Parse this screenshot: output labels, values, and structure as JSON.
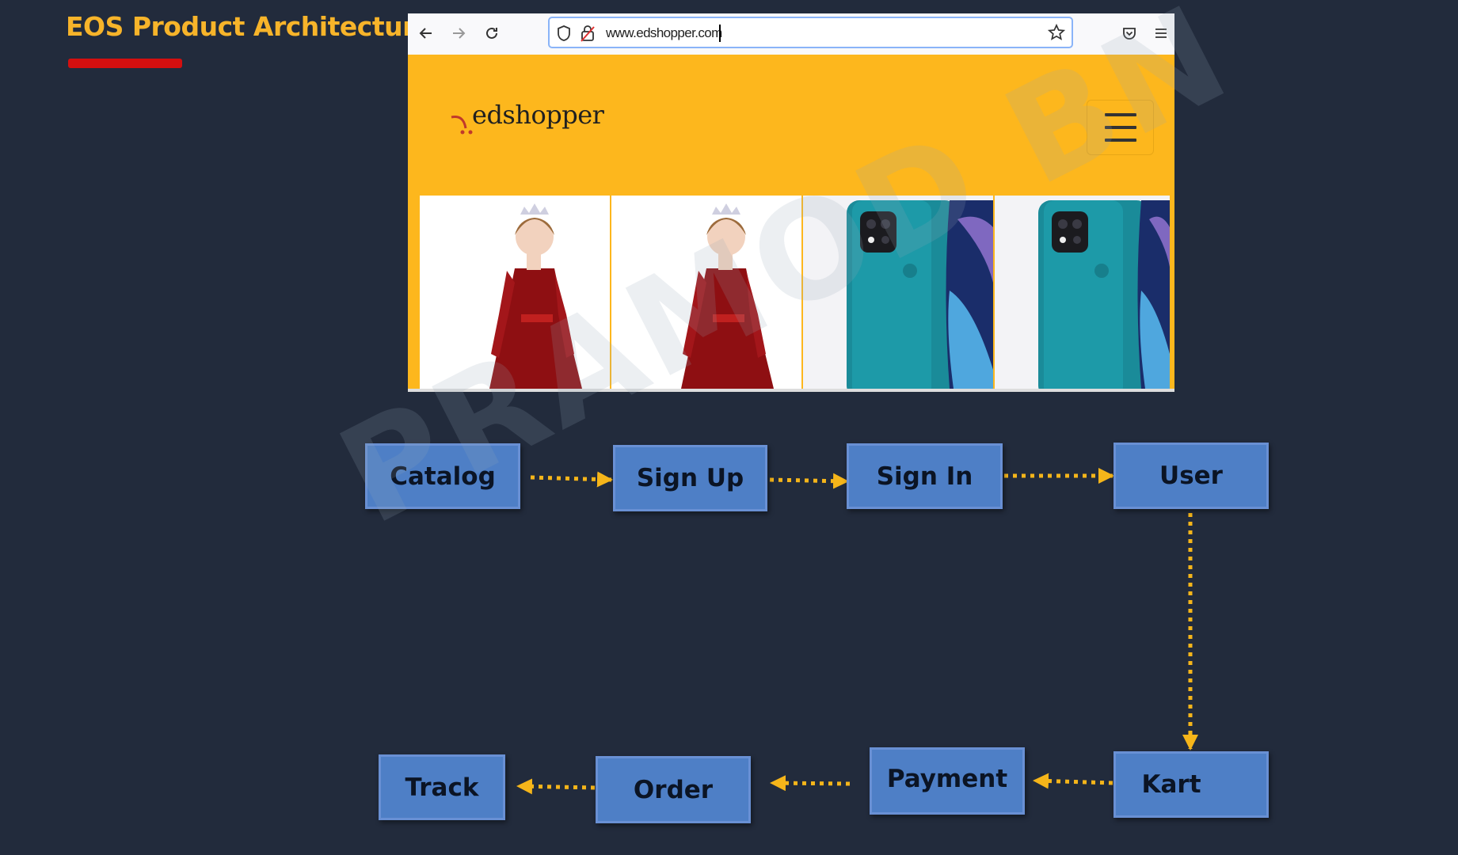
{
  "slide": {
    "title": "EOS Product Architecture"
  },
  "browser": {
    "url": "www.edshopper.com",
    "icons": [
      "back-arrow-icon",
      "forward-arrow-icon",
      "reload-icon",
      "shield-icon",
      "lock-icon",
      "star-icon",
      "pocket-icon",
      "menu-icon"
    ]
  },
  "site": {
    "logo_text": "edshopper",
    "products": [
      {
        "kind": "dress"
      },
      {
        "kind": "dress"
      },
      {
        "kind": "phone"
      },
      {
        "kind": "phone"
      }
    ]
  },
  "flow": {
    "nodes": {
      "catalog": "Catalog",
      "signup": "Sign Up",
      "signin": "Sign In",
      "user": "User",
      "kart": "Kart",
      "payment": "Payment",
      "order": "Order",
      "track": "Track"
    },
    "edges": [
      [
        "catalog",
        "signup"
      ],
      [
        "signup",
        "signin"
      ],
      [
        "signin",
        "user"
      ],
      [
        "user",
        "kart"
      ],
      [
        "kart",
        "payment"
      ],
      [
        "payment",
        "order"
      ],
      [
        "order",
        "track"
      ]
    ]
  },
  "watermark": "PRAMOD BN",
  "colors": {
    "background": "#222b3c",
    "title": "#f7b42a",
    "accent_underline": "#d40f0f",
    "site_header": "#fdb71d",
    "node_fill": "#4e7fc6",
    "arrow": "#f5b51a"
  }
}
